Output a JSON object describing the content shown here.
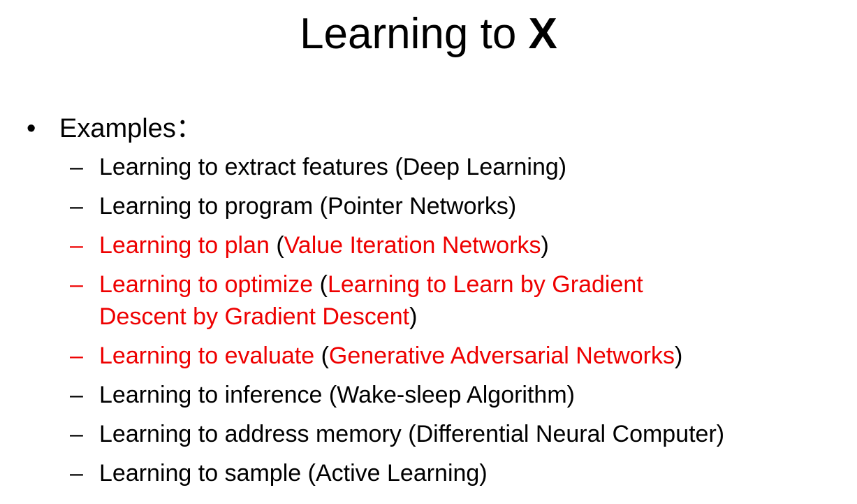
{
  "title": {
    "prefix": "Learning to ",
    "emphasis": "X"
  },
  "bullet": {
    "symbol": "•",
    "label": "Examples："
  },
  "colors": {
    "highlight": "#ee0000",
    "text": "#000000"
  },
  "items": [
    {
      "dash": "–",
      "task": "Learning to extract features",
      "open": " (",
      "ref": "Deep Learning",
      "close": ")",
      "highlight": false
    },
    {
      "dash": "–",
      "task": "Learning to program",
      "open": " (",
      "ref": "Pointer Networks",
      "close": ")",
      "highlight": false
    },
    {
      "dash": "–",
      "task": "Learning to plan",
      "open": " (",
      "ref": "Value Iteration Networks",
      "close": ")",
      "highlight": true
    },
    {
      "dash": "–",
      "task": "Learning to optimize",
      "open": " (",
      "ref": "Learning to Learn by Gradient Descent by Gradient Descent",
      "close": ")",
      "highlight": true
    },
    {
      "dash": "–",
      "task": "Learning to evaluate",
      "open": " (",
      "ref": "Generative Adversarial Networks",
      "close": ")",
      "highlight": true
    },
    {
      "dash": "–",
      "task": "Learning to inference",
      "open": " (",
      "ref": "Wake-sleep Algorithm",
      "close": ")",
      "highlight": false
    },
    {
      "dash": "–",
      "task": "Learning to address memory",
      "open": " (",
      "ref": "Differential Neural Computer",
      "close": ")",
      "highlight": false
    },
    {
      "dash": "–",
      "task": "Learning to sample",
      "open": " (",
      "ref": "Active Learning",
      "close": ")",
      "highlight": false
    }
  ]
}
